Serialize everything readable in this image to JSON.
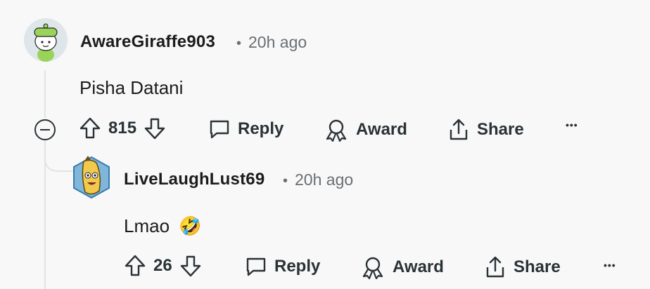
{
  "comments": [
    {
      "username": "AwareGiraffe903",
      "dot": "•",
      "timestamp": "20h ago",
      "body": "Pisha Datani",
      "score": "815",
      "actions": {
        "reply": "Reply",
        "award": "Award",
        "share": "Share",
        "more": "•••"
      }
    },
    {
      "username": "LiveLaughLust69",
      "dot": "•",
      "timestamp": "20h ago",
      "body": "Lmao",
      "emoji": "🤣",
      "score": "26",
      "actions": {
        "reply": "Reply",
        "award": "Award",
        "share": "Share",
        "more": "•••"
      }
    }
  ],
  "icons": {
    "upvote": "upvote-arrow-icon",
    "downvote": "downvote-arrow-icon",
    "reply": "speech-bubble-icon",
    "award": "award-ribbon-icon",
    "share": "share-upload-icon",
    "collapse": "collapse-minus-icon"
  }
}
